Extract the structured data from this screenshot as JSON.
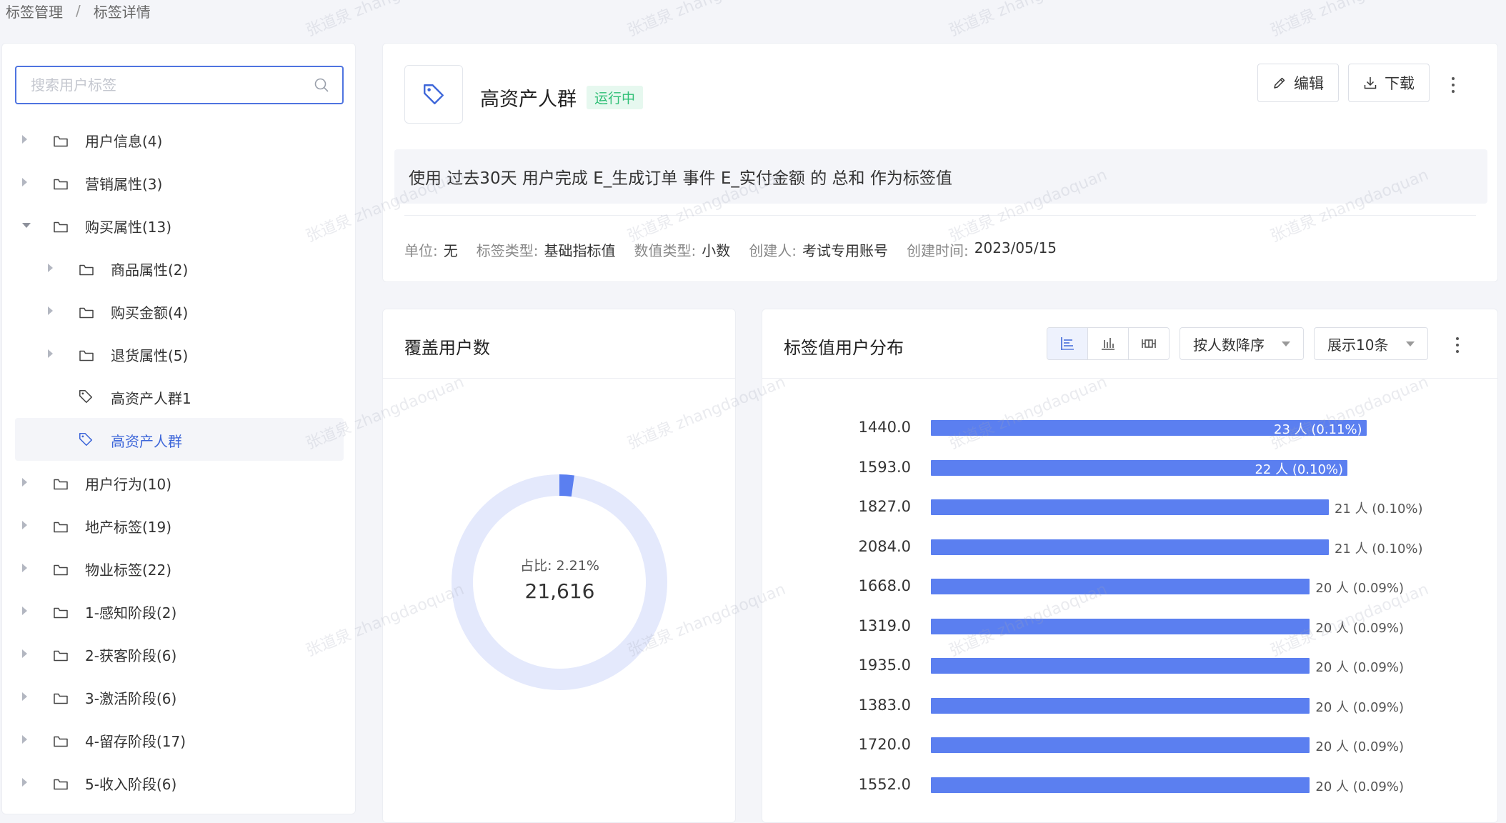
{
  "breadcrumb": {
    "items": [
      "标签管理",
      "标签详情"
    ],
    "separator": "/"
  },
  "sidebar": {
    "search_placeholder": "搜索用户标签",
    "tree": [
      {
        "label": "用户信息(4)",
        "type": "folder",
        "level": 0,
        "expanded": false
      },
      {
        "label": "营销属性(3)",
        "type": "folder",
        "level": 0,
        "expanded": false
      },
      {
        "label": "购买属性(13)",
        "type": "folder",
        "level": 0,
        "expanded": true
      },
      {
        "label": "商品属性(2)",
        "type": "folder",
        "level": 1,
        "expanded": false
      },
      {
        "label": "购买金额(4)",
        "type": "folder",
        "level": 1,
        "expanded": false
      },
      {
        "label": "退货属性(5)",
        "type": "folder",
        "level": 1,
        "expanded": false
      },
      {
        "label": "高资产人群1",
        "type": "tag",
        "level": 1
      },
      {
        "label": "高资产人群",
        "type": "tag",
        "level": 1,
        "active": true
      },
      {
        "label": "用户行为(10)",
        "type": "folder",
        "level": 0,
        "expanded": false
      },
      {
        "label": "地产标签(19)",
        "type": "folder",
        "level": 0,
        "expanded": false
      },
      {
        "label": "物业标签(22)",
        "type": "folder",
        "level": 0,
        "expanded": false
      },
      {
        "label": "1-感知阶段(2)",
        "type": "folder",
        "level": 0,
        "expanded": false
      },
      {
        "label": "2-获客阶段(6)",
        "type": "folder",
        "level": 0,
        "expanded": false
      },
      {
        "label": "3-激活阶段(6)",
        "type": "folder",
        "level": 0,
        "expanded": false
      },
      {
        "label": "4-留存阶段(17)",
        "type": "folder",
        "level": 0,
        "expanded": false
      },
      {
        "label": "5-收入阶段(6)",
        "type": "folder",
        "level": 0,
        "expanded": false
      }
    ]
  },
  "header": {
    "title": "高资产人群",
    "status": "运行中",
    "edit_label": "编辑",
    "download_label": "下载",
    "description": "使用 过去30天 用户完成 E_生成订单 事件 E_实付金额 的 总和 作为标签值",
    "meta": [
      {
        "key": "单位:",
        "value": "无"
      },
      {
        "key": "标签类型:",
        "value": "基础指标值"
      },
      {
        "key": "数值类型:",
        "value": "小数"
      },
      {
        "key": "创建人:",
        "value": "考试专用账号"
      },
      {
        "key": "创建时间:",
        "value": "2023/05/15"
      }
    ]
  },
  "coverage": {
    "title": "覆盖用户数",
    "ratio_label": "占比: ",
    "ratio": "2.21%",
    "ratio_value": 0.0221,
    "count": "21,616",
    "colors": {
      "arc": "#5b7ff0",
      "track": "#e4e9fc"
    }
  },
  "distribution": {
    "title": "标签值用户分布",
    "sort_label": "按人数降序",
    "show_label": "展示10条",
    "chart_icons": [
      "horizontal-bar-icon",
      "vertical-bar-icon",
      "boxplot-icon"
    ]
  },
  "chart_data": {
    "type": "bar",
    "orientation": "horizontal",
    "categories": [
      "1440.0",
      "1593.0",
      "1827.0",
      "2084.0",
      "1668.0",
      "1319.0",
      "1935.0",
      "1383.0",
      "1720.0",
      "1552.0"
    ],
    "values": [
      23,
      22,
      21,
      21,
      20,
      20,
      20,
      20,
      20,
      20
    ],
    "labels": [
      "23 人 (0.11%)",
      "22 人 (0.10%)",
      "21 人 (0.10%)",
      "21 人 (0.10%)",
      "20 人 (0.09%)",
      "20 人 (0.09%)",
      "20 人 (0.09%)",
      "20 人 (0.09%)",
      "20 人 (0.09%)",
      "20 人 (0.09%)"
    ],
    "xlim": [
      0,
      23
    ],
    "color": "#5b7ff0"
  },
  "watermark": "张道泉 zhangdaoquan"
}
